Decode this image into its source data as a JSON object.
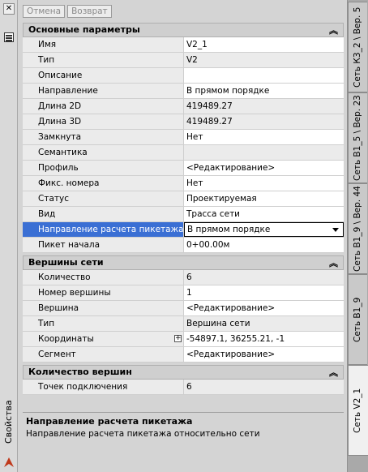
{
  "window": {
    "left_label": "Свойства"
  },
  "toolbar": {
    "cancel_label": "Отмена",
    "back_label": "Возврат"
  },
  "sections": [
    {
      "title": "Основные параметры",
      "rows": [
        {
          "name": "Имя",
          "value": "V2_1"
        },
        {
          "name": "Тип",
          "value": "V2"
        },
        {
          "name": "Описание",
          "value": ""
        },
        {
          "name": "Направление",
          "value": "В прямом порядке"
        },
        {
          "name": "Длина 2D",
          "value": "419489.27"
        },
        {
          "name": "Длина 3D",
          "value": "419489.27"
        },
        {
          "name": "Замкнута",
          "value": "Нет"
        },
        {
          "name": "Семантика",
          "value": ""
        },
        {
          "name": "Профиль",
          "value": "<Редактирование>"
        },
        {
          "name": "Фикс. номера",
          "value": "Нет"
        },
        {
          "name": "Статус",
          "value": "Проектируемая"
        },
        {
          "name": "Вид",
          "value": "Трасса сети"
        },
        {
          "name": "Направление расчета пикетажа",
          "value": "В прямом порядке"
        },
        {
          "name": "Пикет начала",
          "value": "0+00.00м"
        }
      ]
    },
    {
      "title": "Вершины сети",
      "rows": [
        {
          "name": "Количество",
          "value": "6"
        },
        {
          "name": "Номер вершины",
          "value": "1"
        },
        {
          "name": "Вершина",
          "value": "<Редактирование>"
        },
        {
          "name": "Тип",
          "value": "Вершина сети"
        },
        {
          "name": "Координаты",
          "value": "-54897.1, 36255.21, -1"
        },
        {
          "name": "Сегмент",
          "value": "<Редактирование>"
        }
      ]
    },
    {
      "title": "Количество вершин",
      "rows": [
        {
          "name": "Точек подключения",
          "value": "6"
        }
      ]
    }
  ],
  "description": {
    "title": "Направление расчета пикетажа",
    "text": "Направление расчета пикетажа относительно сети"
  },
  "tabs": [
    "Сеть К3_2 \\ Вер. 5",
    "Сеть В1_5 \\ Вер. 23",
    "Сеть В1_9 \\ Вер. 44",
    "Сеть В1_9",
    "Сеть V2_1"
  ],
  "colors": {
    "selection": "#3a6fd4"
  }
}
